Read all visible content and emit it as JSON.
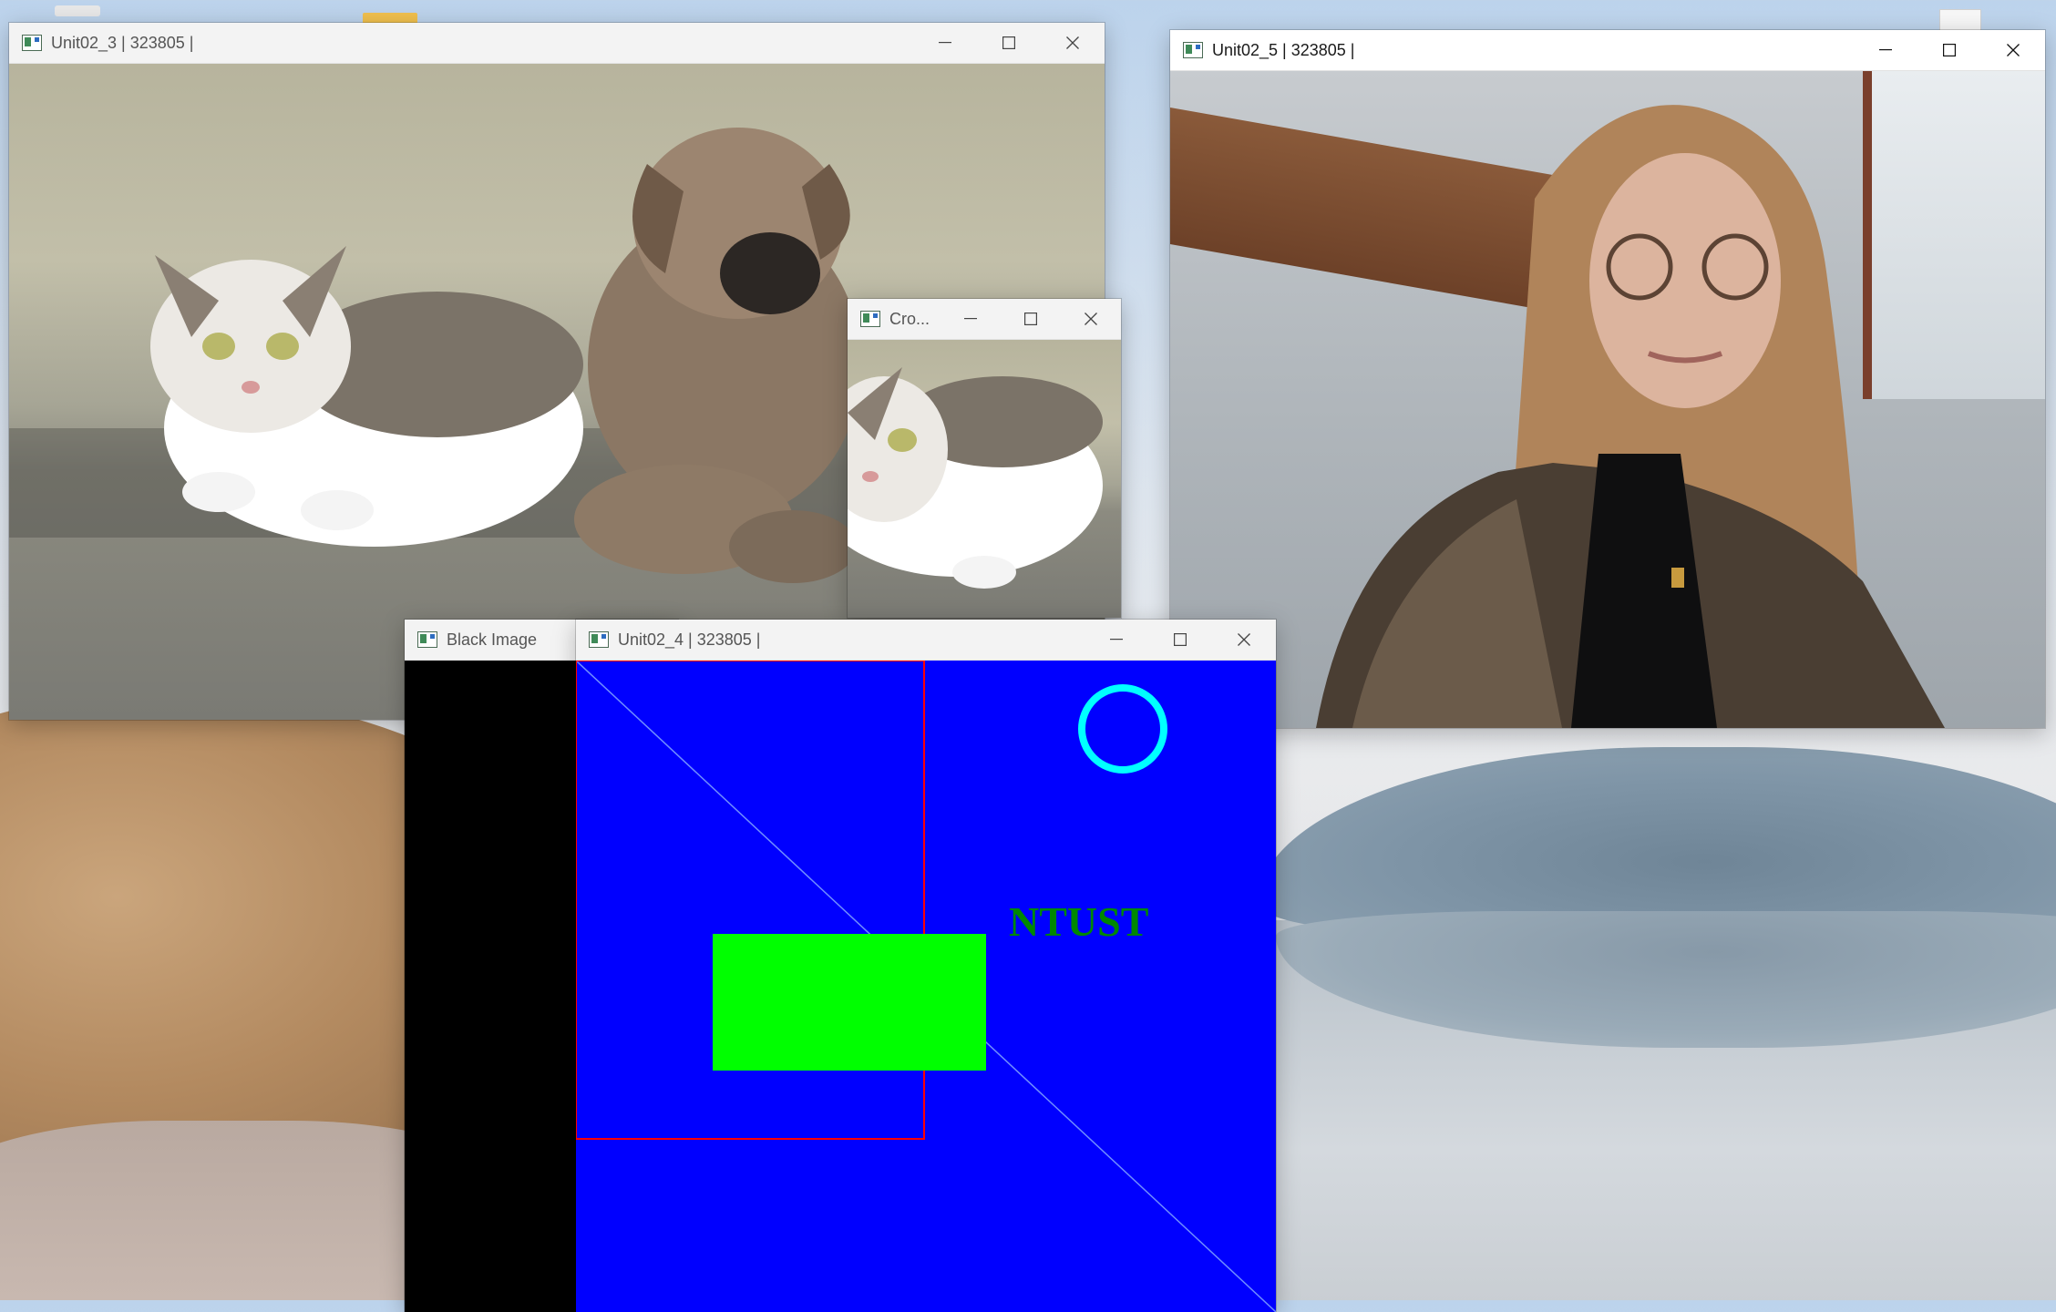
{
  "desktop": {
    "wallpaper": "desert and grass islands landscape"
  },
  "windows": {
    "unit02_3": {
      "title": "Unit02_3 | 323805 |"
    },
    "crop": {
      "title": "Cro..."
    },
    "unit02_5": {
      "title": "Unit02_5 | 323805 |"
    },
    "black_image": {
      "title": "Black Image"
    },
    "unit02_4": {
      "title": "Unit02_4 | 323805 |",
      "canvas_text": "NTUST",
      "colors": {
        "background": "#0000ff",
        "line": "#6f8dff",
        "rectangle_outline": "#ff0000",
        "filled_rectangle": "#00ff00",
        "circle": "#00ffff",
        "text": "#008800"
      }
    }
  },
  "controls": {
    "minimize": "minimize-icon",
    "maximize": "maximize-icon",
    "close": "close-icon"
  }
}
